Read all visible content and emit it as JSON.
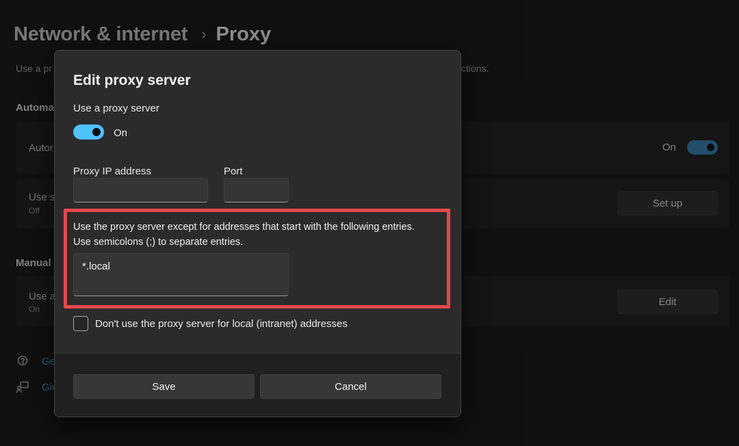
{
  "breadcrumb": {
    "parent": "Network & internet",
    "separator": "›",
    "current": "Proxy"
  },
  "background": {
    "description_left": "Use a pr",
    "description_right": "ctions.",
    "automatic_heading": "Automa",
    "auto_detect_title": "Autor",
    "auto_detect_state": "On",
    "setup_script_title": "Use s",
    "setup_script_sub": "Off",
    "setup_button": "Set up",
    "manual_heading": "Manual",
    "manual_title": "Use a",
    "manual_sub": "On",
    "edit_button": "Edit",
    "link_help": "Ge",
    "link_feedback": "Giv"
  },
  "dialog": {
    "title": "Edit proxy server",
    "use_proxy_label": "Use a proxy server",
    "toggle_state": "On",
    "ip_label": "Proxy IP address",
    "ip_value": "",
    "port_label": "Port",
    "port_value": "",
    "exceptions_line1": "Use the proxy server except for addresses that start with the following entries.",
    "exceptions_line2": "Use semicolons (;) to separate entries.",
    "exceptions_value": "*.local",
    "local_checkbox_label": "Don't use the proxy server for local (intranet) addresses",
    "local_checkbox_checked": false,
    "save_label": "Save",
    "cancel_label": "Cancel"
  },
  "colors": {
    "accent": "#4cc2ff",
    "highlight": "#e5484d"
  }
}
